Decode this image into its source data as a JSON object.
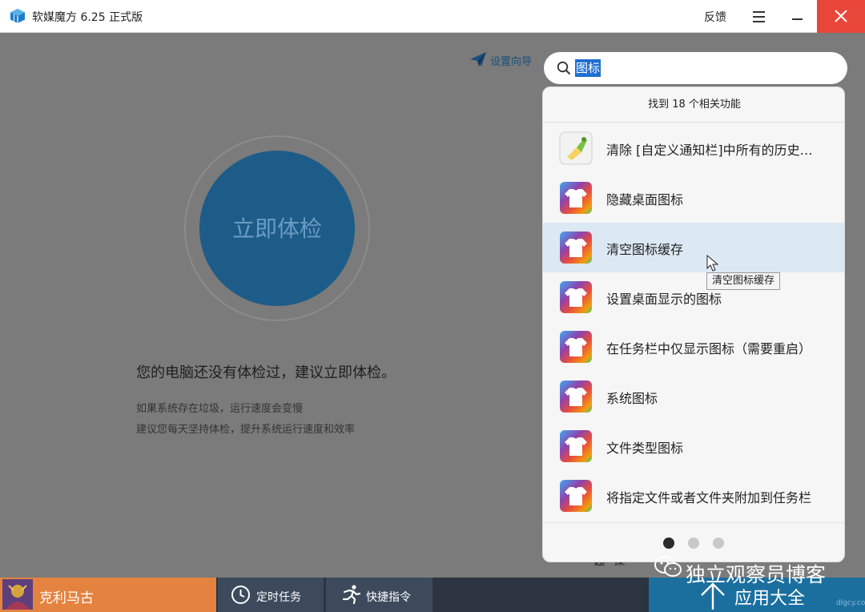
{
  "window": {
    "title": "软媒魔方 6.25 正式版",
    "feedback": "反馈"
  },
  "main": {
    "wizard_label": "设置向导",
    "check_button": "立即体检",
    "headline": "您的电脑还没有体检过，建议立即体检。",
    "tip1": "如果系统存在垃圾，运行速度会变慢",
    "tip2": "建议您每天坚持体检，提升系统运行速度和效率",
    "partial_text": "起 · 屎"
  },
  "search": {
    "value": "图标"
  },
  "results": {
    "header": "找到 18 个相关功能",
    "items": [
      {
        "label": "清除 [自定义通知栏]中所有的历史…",
        "icon": "broom-icon"
      },
      {
        "label": "隐藏桌面图标",
        "icon": "tshirt-icon"
      },
      {
        "label": "清空图标缓存",
        "icon": "tshirt-icon"
      },
      {
        "label": "设置桌面显示的图标",
        "icon": "tshirt-icon"
      },
      {
        "label": "在任务栏中仅显示图标（需要重启）",
        "icon": "tshirt-icon"
      },
      {
        "label": "系统图标",
        "icon": "tshirt-icon"
      },
      {
        "label": "文件类型图标",
        "icon": "tshirt-icon"
      },
      {
        "label": "将指定文件或者文件夹附加到任务栏",
        "icon": "tshirt-icon"
      }
    ],
    "current_page": 1,
    "page_count": 3,
    "tooltip": "清空图标缓存"
  },
  "bottombar": {
    "user_name": "克利马古",
    "schedule_label": "定时任务",
    "command_label": "快捷指令",
    "apps_label": "应用大全"
  },
  "watermark": {
    "text": "独立观察员博客",
    "small": "dlgcy.com"
  },
  "colors": {
    "accent": "#1d5c88",
    "close": "#e9463a",
    "user": "#e4833f",
    "apps": "#1b6f9f"
  }
}
